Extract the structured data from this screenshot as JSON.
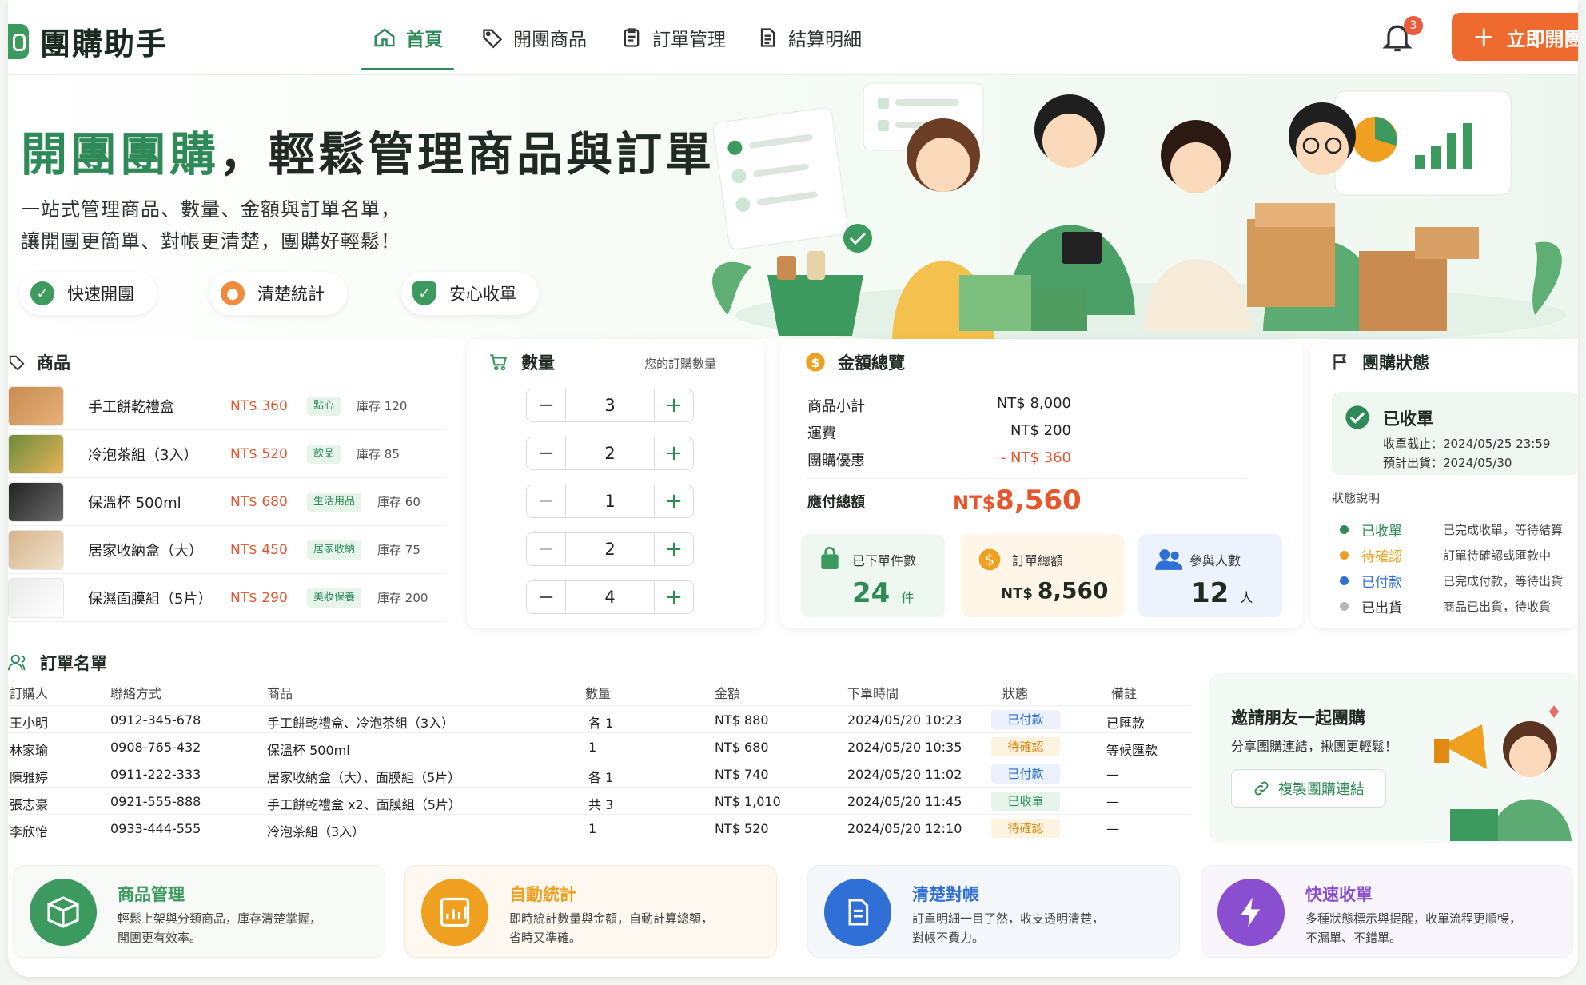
{
  "app": {
    "name": "團購助手",
    "notification_count": "3",
    "cta_label": "立即開團"
  },
  "nav": [
    {
      "label": "首頁",
      "icon": "home-icon",
      "active": true
    },
    {
      "label": "開團商品",
      "icon": "tag-icon"
    },
    {
      "label": "訂單管理",
      "icon": "clipboard-icon"
    },
    {
      "label": "結算明細",
      "icon": "document-icon"
    }
  ],
  "hero": {
    "title_highlight": "開團團購",
    "title_rest": "，輕鬆管理商品與訂單",
    "subtitle_line1": "一站式管理商品、數量、金額與訂單名單，",
    "subtitle_line2": "讓開團更簡單、對帳更清楚，團購好輕鬆！",
    "pills": [
      "快速開團",
      "清楚統計",
      "安心收單"
    ]
  },
  "products": {
    "title": "商品",
    "items": [
      {
        "name": "手工餅乾禮盒",
        "price": "NT$ 360",
        "tag": "點心",
        "stock": "庫存 120"
      },
      {
        "name": "冷泡茶組（3入）",
        "price": "NT$ 520",
        "tag": "飲品",
        "stock": "庫存 85"
      },
      {
        "name": "保溫杯 500ml",
        "price": "NT$ 680",
        "tag": "生活用品",
        "stock": "庫存 60"
      },
      {
        "name": "居家收納盒（大）",
        "price": "NT$ 450",
        "tag": "居家收納",
        "stock": "庫存 75"
      },
      {
        "name": "保濕面膜組（5片）",
        "price": "NT$ 290",
        "tag": "美妝保養",
        "stock": "庫存 200"
      }
    ]
  },
  "quantity": {
    "title": "數量",
    "hint": "您的訂購數量",
    "values": [
      "3",
      "2",
      "1",
      "2",
      "4"
    ],
    "minus": "−",
    "plus": "+"
  },
  "summary": {
    "title": "金額總覽",
    "rows": [
      {
        "label": "商品小計",
        "value": "NT$ 8,000"
      },
      {
        "label": "運費",
        "value": "NT$ 200"
      },
      {
        "label": "團購優惠",
        "value": "- NT$ 360"
      }
    ],
    "total_label": "應付總額",
    "total_currency": "NT$",
    "total_value": "8,560",
    "stats": [
      {
        "label": "已下單件數",
        "value": "24",
        "unit": "件"
      },
      {
        "label": "訂單總額",
        "prefix": "NT$",
        "value": "8,560"
      },
      {
        "label": "參與人數",
        "value": "12",
        "unit": "人"
      }
    ]
  },
  "status": {
    "title": "團購狀態",
    "current": "已收單",
    "close_time": "收單截止：2024/05/25 23:59",
    "ship_date": "預計出貨：2024/05/30",
    "legend_title": "狀態說明",
    "legend": [
      {
        "name": "已收單",
        "desc": "已完成收單，等待結算",
        "color": "#2e8b57"
      },
      {
        "name": "待確認",
        "desc": "訂單待確認或匯款中",
        "color": "#f0a020"
      },
      {
        "name": "已付款",
        "desc": "已完成付款，等待出貨",
        "color": "#2f6fd6"
      },
      {
        "name": "已出貨",
        "desc": "商品已出貨，待收貨",
        "color": "#b5b5b5"
      }
    ]
  },
  "orders": {
    "title": "訂單名單",
    "columns": [
      "訂購人",
      "聯絡方式",
      "商品",
      "數量",
      "金額",
      "下單時間",
      "狀態",
      "備註"
    ],
    "rows": [
      {
        "buyer": "王小明",
        "phone": "0912-345-678",
        "items": "手工餅乾禮盒、冷泡茶組（3入）",
        "qty": "各 1",
        "amount": "NT$ 880",
        "time": "2024/05/20 10:23",
        "status": "已付款",
        "note": "已匯款"
      },
      {
        "buyer": "林家瑜",
        "phone": "0908-765-432",
        "items": "保溫杯 500ml",
        "qty": "1",
        "amount": "NT$ 680",
        "time": "2024/05/20 10:35",
        "status": "待確認",
        "note": "等候匯款"
      },
      {
        "buyer": "陳雅婷",
        "phone": "0911-222-333",
        "items": "居家收納盒（大）、面膜組（5片）",
        "qty": "各 1",
        "amount": "NT$ 740",
        "time": "2024/05/20 11:02",
        "status": "已付款",
        "note": "—"
      },
      {
        "buyer": "張志豪",
        "phone": "0921-555-888",
        "items": "手工餅乾禮盒 x2、面膜組（5片）",
        "qty": "共 3",
        "amount": "NT$ 1,010",
        "time": "2024/05/20 11:45",
        "status": "已收單",
        "note": "—"
      },
      {
        "buyer": "李欣怡",
        "phone": "0933-444-555",
        "items": "冷泡茶組（3入）",
        "qty": "1",
        "amount": "NT$ 520",
        "time": "2024/05/20 12:10",
        "status": "待確認",
        "note": "—"
      }
    ]
  },
  "invite": {
    "title": "邀請朋友一起團購",
    "subtitle": "分享團購連結，揪團更輕鬆！",
    "button": "複製團購連結"
  },
  "features": [
    {
      "title": "商品管理",
      "line1": "輕鬆上架與分類商品，庫存清楚掌握，",
      "line2": "開團更有效率。",
      "color": "#3c9a5f"
    },
    {
      "title": "自動統計",
      "line1": "即時統計數量與金額，自動計算總額，",
      "line2": "省時又準確。",
      "color": "#f0a020"
    },
    {
      "title": "清楚對帳",
      "line1": "訂單明細一目了然，收支透明清楚，",
      "line2": "對帳不費力。",
      "color": "#2f6fd6"
    },
    {
      "title": "快速收單",
      "line1": "多種狀態標示與提醒，收單流程更順暢，",
      "line2": "不漏單、不錯單。",
      "color": "#8a4fd0"
    }
  ]
}
